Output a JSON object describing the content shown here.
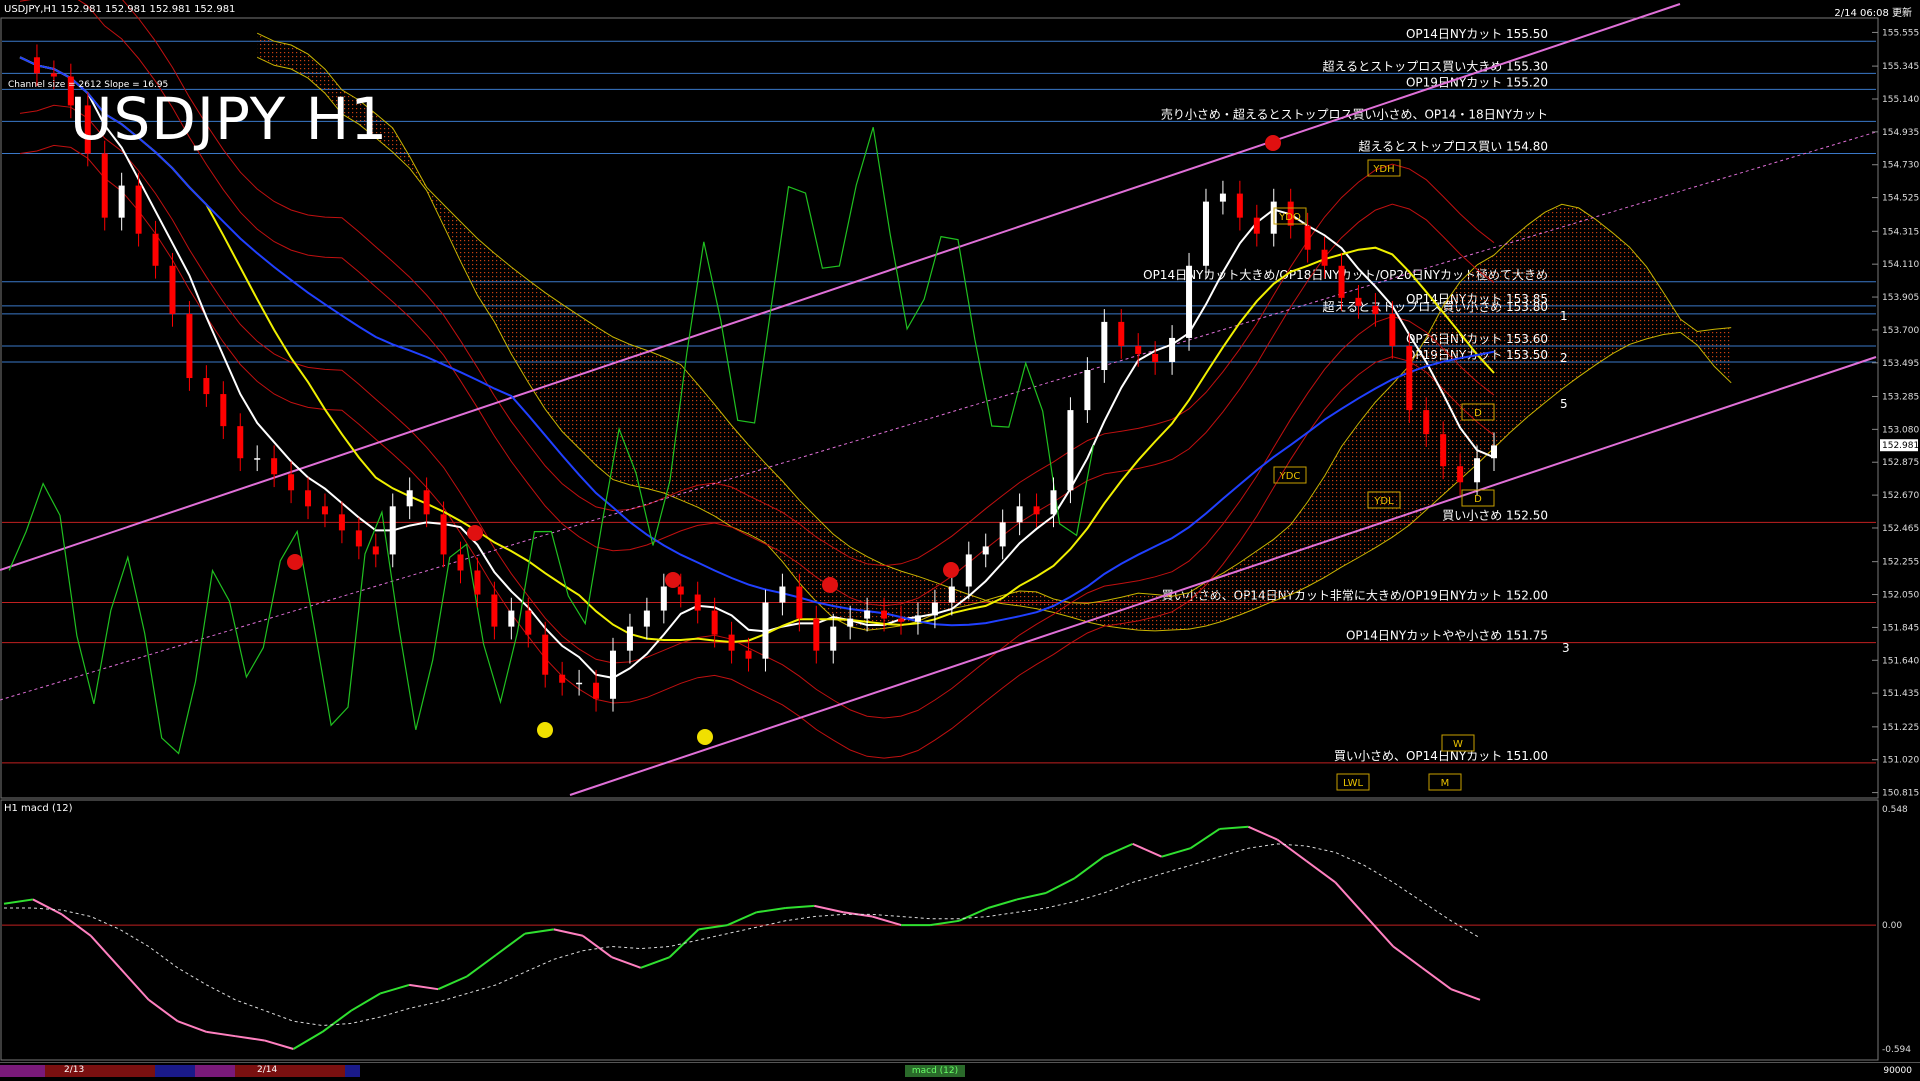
{
  "header": {
    "symbol_line": "USDJPY,H1 152.981 152.981 152.981 152.981",
    "datetime": "2/14 06:08 更新",
    "big_title": "USDJPY H1",
    "channel_info": "Channel size = 2612 Slope = 16.95",
    "macd_label": "H1 macd (12)"
  },
  "chart_data": {
    "type": "line",
    "title": "USDJPY H1",
    "ylim": [
      150.8,
      155.62
    ],
    "y_ticks": [
      155.555,
      155.345,
      155.14,
      154.935,
      154.73,
      154.525,
      154.315,
      154.11,
      153.905,
      153.7,
      153.495,
      153.285,
      153.08,
      152.875,
      152.67,
      152.465,
      152.255,
      152.05,
      151.845,
      151.64,
      151.435,
      151.225,
      151.02,
      150.815
    ],
    "current_price": "152.981",
    "levels": [
      {
        "label": "OP14日NYカット 155.50",
        "value": 155.5,
        "color": "#3a78c8"
      },
      {
        "label": "超えるとストップロス買い大きめ 155.30",
        "value": 155.3,
        "color": "#3a78c8"
      },
      {
        "label": "OP19日NYカット 155.20",
        "value": 155.2,
        "color": "#3a78c8"
      },
      {
        "label": "売り小さめ・超えるとストップロス買い小さめ、OP14・18日NYカット",
        "value": 155.0,
        "color": "#3a78c8"
      },
      {
        "label": "超えるとストップロス買い 154.80",
        "value": 154.8,
        "color": "#3a78c8"
      },
      {
        "label": "OP14日NYカット大きめ/OP18日NYカット/OP20日NYカット極めて大きめ",
        "value": 154.0,
        "color": "#3a78c8"
      },
      {
        "label": "OP14日NYカット 153.85",
        "value": 153.85,
        "color": "#3a78c8"
      },
      {
        "label": "超えるとストップロス買い小さめ 153.80",
        "value": 153.8,
        "color": "#3a78c8"
      },
      {
        "label": "OP20日NYカット 153.60",
        "value": 153.6,
        "color": "#3a78c8"
      },
      {
        "label": "OP19日NYカット 153.50",
        "value": 153.5,
        "color": "#3a78c8"
      },
      {
        "label": "買い小さめ 152.50",
        "value": 152.5,
        "color": "#c02020"
      },
      {
        "label": "買い小さめ、OP14日NYカット非常に大きめ/OP19日NYカット 152.00",
        "value": 152.0,
        "color": "#c02020"
      },
      {
        "label": "OP14日NYカットやや小さめ 151.75",
        "value": 151.75,
        "color": "#c02020"
      },
      {
        "label": "買い小さめ、OP14日NYカット 151.00",
        "value": 151.0,
        "color": "#c02020"
      }
    ],
    "markers": [
      "YDH",
      "YDO",
      "YDC",
      "YDL",
      "LWL",
      "D",
      "D",
      "W",
      "M"
    ],
    "wave_labels": [
      "1",
      "2",
      "3",
      "5"
    ],
    "series": [
      {
        "values": [
          155.4,
          155.3,
          155.28,
          155.1,
          154.8,
          154.4,
          154.6,
          154.3,
          154.1,
          153.8,
          153.4,
          153.3,
          153.1,
          152.9,
          152.9,
          152.8,
          152.7,
          152.6,
          152.55,
          152.45,
          152.35,
          152.3,
          152.6,
          152.7,
          152.55,
          152.3,
          152.2,
          152.05,
          151.85,
          151.95,
          151.8,
          151.55,
          151.5,
          151.5,
          151.4,
          151.7,
          151.85,
          151.95,
          152.1,
          152.05,
          151.95,
          151.8,
          151.7,
          151.65,
          152.0,
          152.1,
          151.9,
          151.7,
          151.85,
          151.9,
          151.95,
          151.9,
          151.88,
          151.92,
          152.0,
          152.1,
          152.3,
          152.35,
          152.5,
          152.6,
          152.55,
          152.7,
          153.2,
          153.45,
          153.75,
          153.6,
          153.55,
          153.5,
          153.65,
          154.1,
          154.5,
          154.55,
          154.4,
          154.3,
          154.5,
          154.35,
          154.2,
          154.1,
          153.9,
          153.85,
          153.8,
          153.6,
          153.2,
          153.05,
          152.85,
          152.75,
          152.9,
          152.98
        ]
      },
      {
        "name": "macd",
        "values": [
          0.1,
          0.12,
          0.05,
          -0.05,
          -0.2,
          -0.35,
          -0.45,
          -0.5,
          -0.52,
          -0.54,
          -0.58,
          -0.5,
          -0.4,
          -0.32,
          -0.28,
          -0.3,
          -0.24,
          -0.14,
          -0.04,
          -0.02,
          -0.05,
          -0.15,
          -0.2,
          -0.15,
          -0.02,
          0.0,
          0.06,
          0.08,
          0.09,
          0.06,
          0.04,
          0.0,
          0.0,
          0.02,
          0.08,
          0.12,
          0.15,
          0.22,
          0.32,
          0.38,
          0.32,
          0.36,
          0.45,
          0.46,
          0.4,
          0.3,
          0.2,
          0.05,
          -0.1,
          -0.2,
          -0.3,
          -0.35
        ]
      },
      {
        "name": "signal",
        "values": [
          0.08,
          0.08,
          0.07,
          0.04,
          -0.02,
          -0.1,
          -0.2,
          -0.28,
          -0.35,
          -0.4,
          -0.45,
          -0.47,
          -0.46,
          -0.43,
          -0.39,
          -0.36,
          -0.32,
          -0.28,
          -0.22,
          -0.16,
          -0.12,
          -0.1,
          -0.11,
          -0.1,
          -0.07,
          -0.04,
          -0.01,
          0.02,
          0.04,
          0.05,
          0.05,
          0.04,
          0.03,
          0.03,
          0.04,
          0.06,
          0.08,
          0.11,
          0.15,
          0.2,
          0.24,
          0.28,
          0.32,
          0.36,
          0.38,
          0.37,
          0.34,
          0.28,
          0.2,
          0.11,
          0.02,
          -0.06
        ]
      }
    ],
    "macd_ylim": [
      -0.594,
      0.548
    ],
    "macd_ticks": [
      "0.548",
      "0.00",
      "-0.594"
    ]
  },
  "bottom_bar": {
    "dates": [
      "2/13",
      "2/14"
    ],
    "macd_tab": "macd (12)",
    "end_label": "90000"
  },
  "colors": {
    "background": "#000000",
    "bull": "#ffffff",
    "bear": "#ff0000",
    "channel": "#e070d8",
    "ma_white": "#ffffff",
    "ma_yellow": "#f0f000",
    "ma_blue": "#2040ff",
    "chikou": "#20c020",
    "cloud": "#c84010"
  }
}
